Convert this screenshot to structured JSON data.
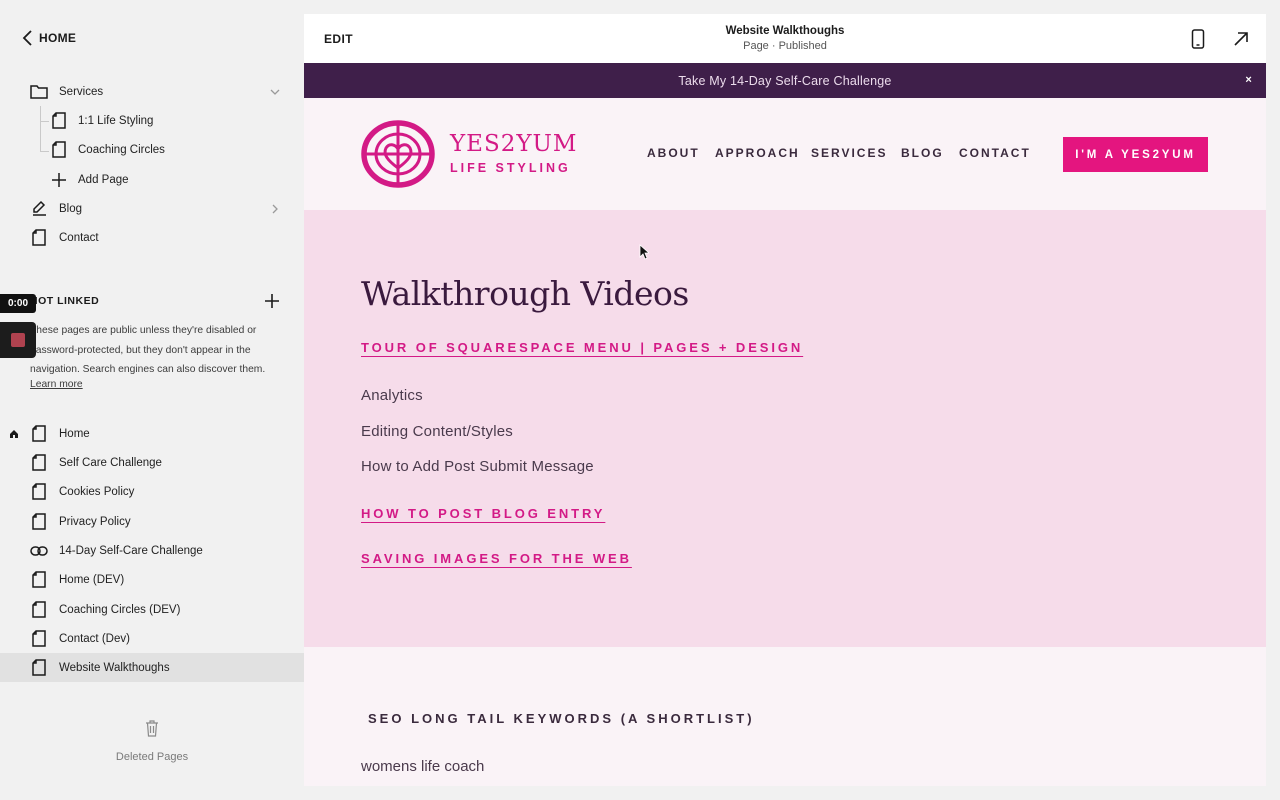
{
  "sidebar": {
    "home_label": "HOME",
    "services": {
      "label": "Services",
      "children": [
        "1:1 Life Styling",
        "Coaching Circles"
      ],
      "add_page_label": "Add Page"
    },
    "blog_label": "Blog",
    "contact_label": "Contact",
    "not_linked": {
      "title": "NOT LINKED",
      "description": "These pages are public unless they're disabled or password-protected, but they don't appear in the navigation. Search engines can also discover them.",
      "learn_more": "Learn more"
    },
    "pages": [
      {
        "label": "Home",
        "icon": "page-icon"
      },
      {
        "label": "Self Care Challenge",
        "icon": "page-icon"
      },
      {
        "label": "Cookies Policy",
        "icon": "page-icon"
      },
      {
        "label": "Privacy Policy",
        "icon": "page-icon"
      },
      {
        "label": "14-Day Self-Care Challenge",
        "icon": "link-icon"
      },
      {
        "label": "Home (DEV)",
        "icon": "page-icon"
      },
      {
        "label": "Coaching Circles (DEV)",
        "icon": "page-icon"
      },
      {
        "label": "Contact (Dev)",
        "icon": "page-icon"
      },
      {
        "label": "Website Walkthoughs",
        "icon": "page-icon"
      }
    ],
    "deleted_label": "Deleted Pages"
  },
  "recorder": {
    "time": "0:00"
  },
  "editor": {
    "edit_label": "EDIT",
    "page_title": "Website Walkthoughs",
    "page_status": "Page · Published"
  },
  "site": {
    "announcement": "Take My 14-Day Self-Care Challenge",
    "announcement_close": "×",
    "logo_name": "YES2YUM",
    "logo_tagline": "LIFE STYLING",
    "nav": [
      "ABOUT",
      "APPROACH",
      "SERVICES",
      "BLOG",
      "CONTACT"
    ],
    "cta": "I'M A YES2YUM",
    "walkthrough": {
      "heading": "Walkthrough Videos",
      "link1": "TOUR OF SQUARESPACE MENU | PAGES + DESIGN",
      "items": [
        "Analytics",
        "Editing Content/Styles",
        "How to Add Post Submit Message"
      ],
      "link2": "HOW TO POST BLOG ENTRY",
      "link3": "SAVING IMAGES FOR THE WEB"
    },
    "seo": {
      "heading": "SEO LONG TAIL KEYWORDS (A SHORTLIST)",
      "items": [
        "womens life coach"
      ]
    }
  },
  "colors": {
    "brand_pink": "#d31a86",
    "cta_pink": "#e4157f",
    "announcement_bg": "#3f1f4a",
    "section_pink": "#f6dcea",
    "header_bg": "#faf3f7"
  }
}
